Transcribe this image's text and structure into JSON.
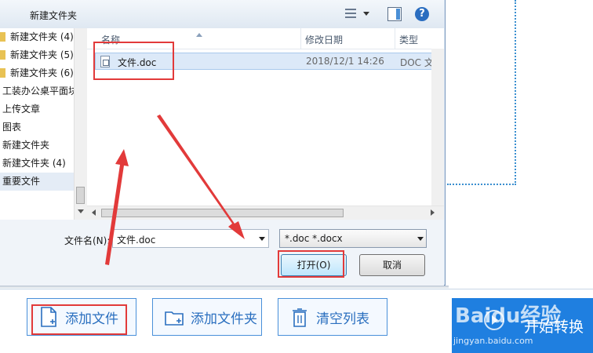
{
  "dialog": {
    "toolbar": {
      "new_folder_label": "新建文件夹",
      "help_glyph": "?"
    },
    "nav_items": [
      {
        "label": "新建文件夹 (4)",
        "folder": true
      },
      {
        "label": "新建文件夹 (5)",
        "folder": true
      },
      {
        "label": "新建文件夹 (6)",
        "folder": true
      },
      {
        "label": "工装办公桌平面块",
        "folder": false
      },
      {
        "label": "上传文章",
        "folder": false
      },
      {
        "label": "图表",
        "folder": false
      },
      {
        "label": "新建文件夹",
        "folder": false
      },
      {
        "label": "新建文件夹 (4)",
        "folder": false
      },
      {
        "label": "重要文件",
        "folder": false,
        "selected": true
      }
    ],
    "columns": {
      "name": "名称",
      "date": "修改日期",
      "type": "类型"
    },
    "files": [
      {
        "name": "文件.doc",
        "date": "2018/12/1 14:26",
        "type": "DOC 文档"
      }
    ],
    "filename_label": "文件名(N):",
    "filename_value": "文件.doc",
    "filetype_value": "*.doc *.docx",
    "open_label": "打开(O)",
    "cancel_label": "取消"
  },
  "app": {
    "add_file_label": "添加文件",
    "add_folder_label": "添加文件夹",
    "clear_list_label": "清空列表",
    "start_label": "开始转换"
  },
  "watermark": {
    "brand": "Baidu经验",
    "url": "jingyan.baidu.com"
  },
  "colors": {
    "accent": "#1f7fe0",
    "highlight_red": "#e23a3a",
    "app_button_text": "#2a6fbf"
  }
}
